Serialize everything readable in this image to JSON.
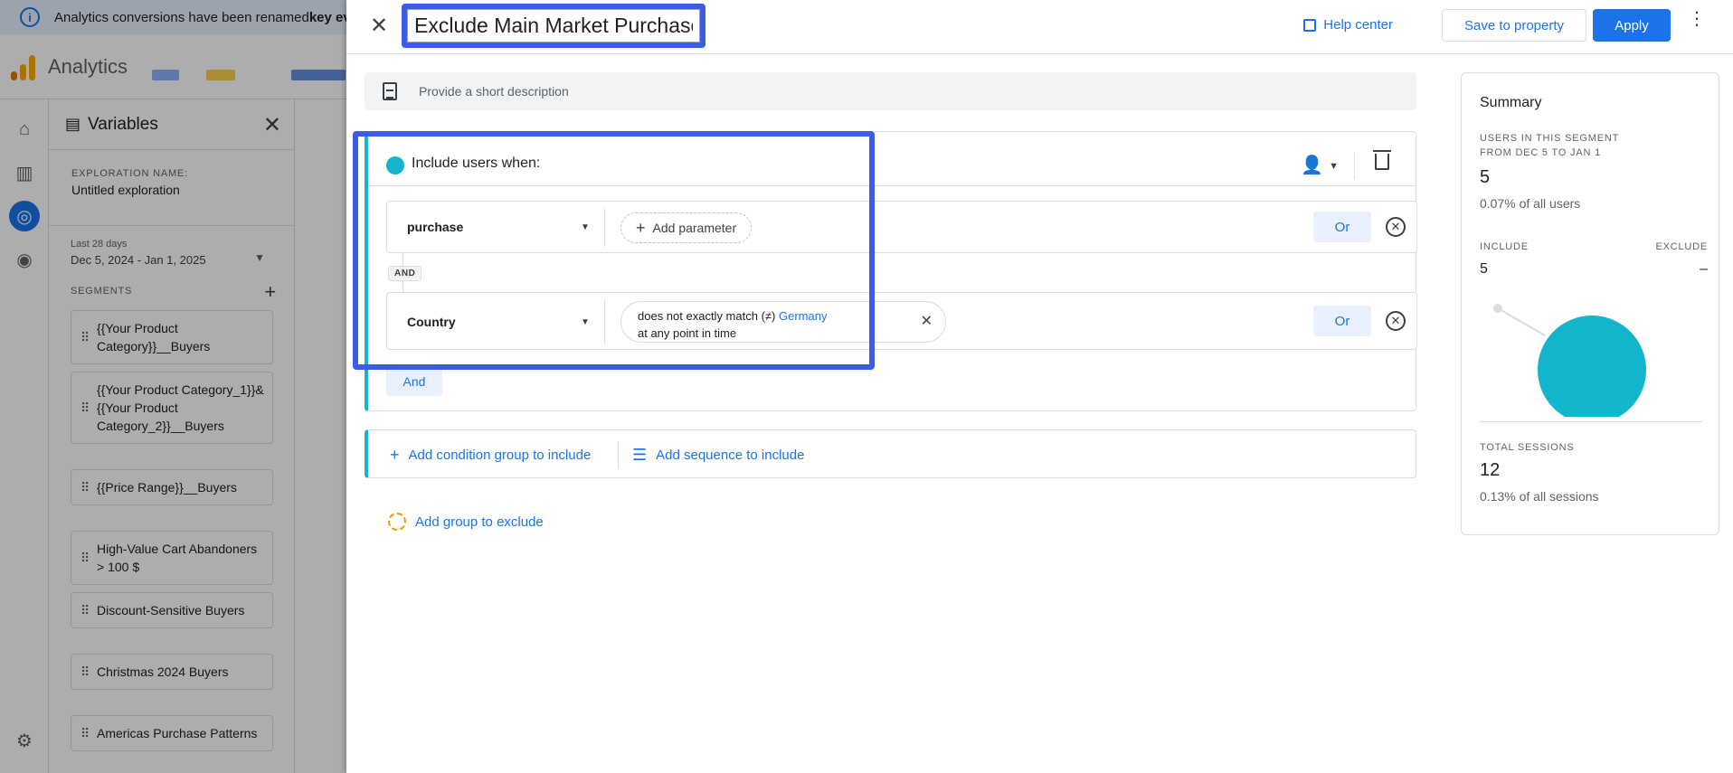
{
  "banner": {
    "text": "Analytics conversions have been renamed ",
    "bold": "key eve"
  },
  "topbar": {
    "app_name": "Analytics"
  },
  "variables": {
    "title": "Variables",
    "exploration_label": "EXPLORATION NAME:",
    "exploration_name": "Untitled exploration",
    "date_label": "Last 28 days",
    "date_range": "Dec 5, 2024 - Jan 1, 2025",
    "segments_label": "SEGMENTS",
    "segments": [
      "{{Your Product Category}}__Buyers",
      "{{Your Product Category_1}}&{{Your Product Category_2}}__Buyers",
      "{{Price Range}}__Buyers",
      "High-Value Cart Abandoners > 100 $",
      "Discount-Sensitive Buyers",
      "Christmas 2024 Buyers",
      "Americas Purchase Patterns"
    ]
  },
  "dialog": {
    "segment_name": "Exclude Main Market Purchasers",
    "help_center": "Help center",
    "save_label": "Save to property",
    "apply_label": "Apply",
    "description_placeholder": "Provide a short description",
    "include_label": "Include users when:",
    "conditions": [
      {
        "dimension": "purchase",
        "add_parameter": "Add parameter",
        "or_label": "Or"
      },
      {
        "dimension": "Country",
        "filter_prefix": "does not exactly match (≠) ",
        "filter_value": "Germany",
        "filter_scope": "at any point in time",
        "or_label": "Or"
      }
    ],
    "and_badge": "AND",
    "and_button": "And",
    "add_condition_group": "Add condition group to include",
    "add_sequence": "Add sequence to include",
    "add_exclude": "Add group to exclude"
  },
  "summary": {
    "title": "Summary",
    "users_caption_1": "USERS IN THIS SEGMENT",
    "users_caption_2": "FROM DEC 5 TO JAN 1",
    "users_value": "5",
    "users_pct": "0.07% of all users",
    "include_label": "INCLUDE",
    "exclude_label": "EXCLUDE",
    "include_value": "5",
    "exclude_value": "–",
    "sessions_caption": "TOTAL SESSIONS",
    "sessions_value": "12",
    "sessions_pct": "0.13% of all sessions"
  },
  "colors": {
    "accent": "#1a73e8",
    "teal": "#12b5cb",
    "highlight": "#3d5ce6"
  }
}
